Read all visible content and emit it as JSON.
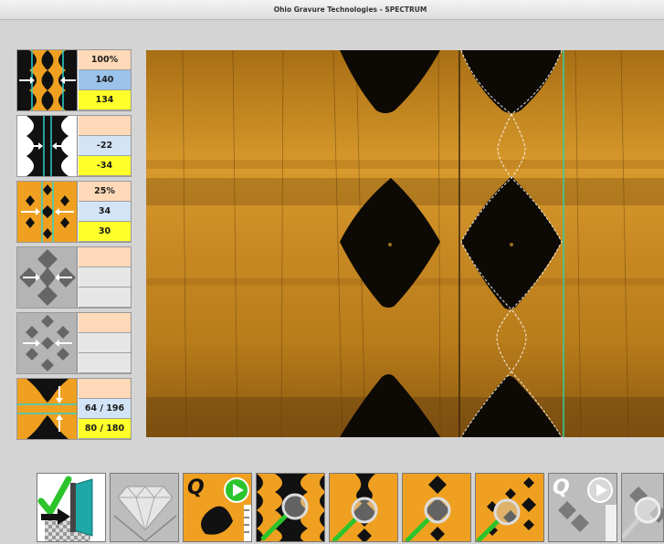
{
  "window": {
    "title": "Ohio Gravure Technologies - SPECTRUM"
  },
  "panels": [
    {
      "id": "horizontal-width",
      "values": [
        "100%",
        "140",
        "134"
      ]
    },
    {
      "id": "channel-width",
      "values": [
        "",
        "-22",
        "-34"
      ]
    },
    {
      "id": "compressed-cell",
      "values": [
        "25%",
        "34",
        "30"
      ]
    },
    {
      "id": "diamond-horizontal",
      "values": [
        "",
        "",
        ""
      ]
    },
    {
      "id": "diamond-diagonal",
      "values": [
        "",
        "",
        ""
      ]
    },
    {
      "id": "vertical-wall",
      "values": [
        "",
        "64 / 196",
        "80 / 180"
      ]
    }
  ],
  "colors": {
    "accent": "#f0a020",
    "peach": "#ffd9b8",
    "blue": "#9bc2ea",
    "light_blue": "#d3e4f6",
    "yellow": "#ffff2a",
    "cyan_line": "#2fd0d0"
  },
  "toolbar": {
    "buttons": [
      {
        "icon": "accept-exit-icon"
      },
      {
        "icon": "diamond-icon"
      },
      {
        "icon": "quick-measure-play-icon",
        "label": "Q"
      },
      {
        "icon": "zoom-cells-icon"
      },
      {
        "icon": "zoom-single-cell-icon"
      },
      {
        "icon": "zoom-channel-icon"
      },
      {
        "icon": "zoom-compressed-icon"
      },
      {
        "icon": "quick-measure-disabled-icon",
        "label": "Q"
      },
      {
        "icon": "zoom-disabled-icon"
      }
    ]
  }
}
